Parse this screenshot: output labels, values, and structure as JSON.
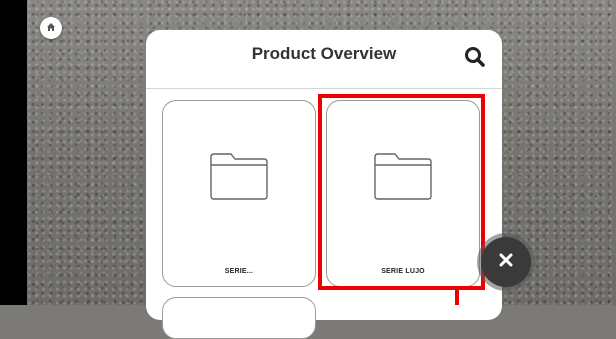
{
  "panel": {
    "title": "Product Overview"
  },
  "icons": {
    "home": "home-icon",
    "search": "search-icon",
    "folder": "folder-icon",
    "close": "close-icon"
  },
  "cards": [
    {
      "label": "SERIE..."
    },
    {
      "label": "SERIE LUJO"
    },
    {
      "label": ""
    }
  ],
  "colors": {
    "highlight": "#ee0000",
    "close_button": "#3a3a3a",
    "panel_bg": "#ffffff"
  }
}
